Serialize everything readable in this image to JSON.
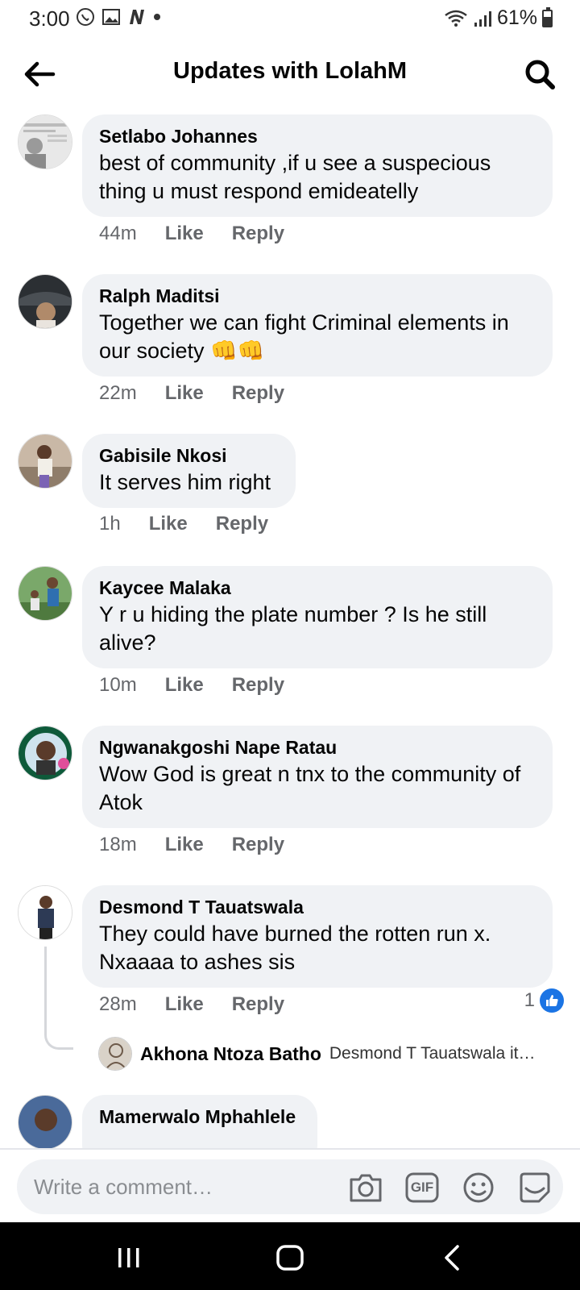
{
  "status_bar": {
    "time": "3:00",
    "battery": "61%"
  },
  "header": {
    "title": "Updates with LolahM"
  },
  "comments": [
    {
      "name": "Setlabo Johannes",
      "text": "best of community ,if u see a suspecious thing u must respond emideatelly",
      "time": "44m",
      "like": "Like",
      "reply": "Reply"
    },
    {
      "name": "Ralph Maditsi",
      "text": "Together we can fight Criminal elements in our society 👊👊",
      "time": "22m",
      "like": "Like",
      "reply": "Reply"
    },
    {
      "name": "Gabisile Nkosi",
      "text": "It serves him right",
      "time": "1h",
      "like": "Like",
      "reply": "Reply"
    },
    {
      "name": "Kaycee Malaka",
      "text": "Y r u hiding the plate number ? Is he still alive?",
      "time": "10m",
      "like": "Like",
      "reply": "Reply"
    },
    {
      "name": "Ngwanakgoshi Nape Ratau",
      "text": "Wow God is great n tnx to the community of Atok",
      "time": "18m",
      "like": "Like",
      "reply": "Reply"
    },
    {
      "name": "Desmond T Tauatswala",
      "text": "They could have burned the rotten run x. Nxaaaa to ashes sis",
      "time": "28m",
      "like": "Like",
      "reply": "Reply",
      "reaction_count": "1",
      "reply_preview": {
        "name": "Akhona Ntoza Batho",
        "text": "Desmond T Tauatswala it…"
      }
    },
    {
      "name": "Mamerwalo Mphahlele"
    }
  ],
  "composer": {
    "placeholder": "Write a comment…",
    "icons": [
      "camera-icon",
      "gif-icon",
      "emoji-icon",
      "sticker-icon"
    ],
    "gif_label": "GIF"
  },
  "colors": {
    "bubble": "#f0f2f5",
    "meta_text": "#65676b",
    "like_blue": "#1b74e4"
  }
}
